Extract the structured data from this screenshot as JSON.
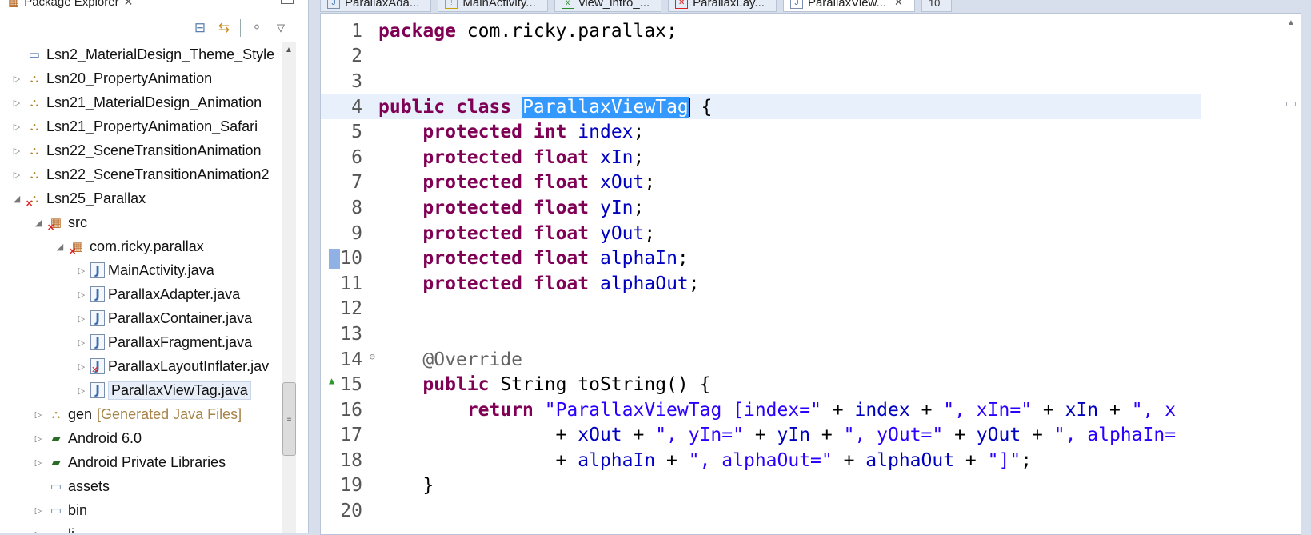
{
  "explorer": {
    "title": "Package Explorer",
    "tree": [
      {
        "depth": 0,
        "arrow": "",
        "icon": "folder-icon",
        "label": "Lsn2_MaterialDesign_Theme_Style"
      },
      {
        "depth": 0,
        "arrow": "▷",
        "icon": "project-icon",
        "label": "Lsn20_PropertyAnimation"
      },
      {
        "depth": 0,
        "arrow": "▷",
        "icon": "project-icon",
        "label": "Lsn21_MaterialDesign_Animation"
      },
      {
        "depth": 0,
        "arrow": "▷",
        "icon": "project-icon",
        "label": "Lsn21_PropertyAnimation_Safari"
      },
      {
        "depth": 0,
        "arrow": "▷",
        "icon": "project-icon",
        "label": "Lsn22_SceneTransitionAnimation"
      },
      {
        "depth": 0,
        "arrow": "▷",
        "icon": "project-icon",
        "label": "Lsn22_SceneTransitionAnimation2"
      },
      {
        "depth": 0,
        "arrow": "◢",
        "icon": "project-error-icon",
        "label": "Lsn25_Parallax"
      },
      {
        "depth": 1,
        "arrow": "◢",
        "icon": "source-folder-error-icon",
        "label": "src"
      },
      {
        "depth": 2,
        "arrow": "◢",
        "icon": "package-error-icon",
        "label": "com.ricky.parallax"
      },
      {
        "depth": 3,
        "arrow": "▷",
        "icon": "java-warning-icon",
        "label": "MainActivity.java"
      },
      {
        "depth": 3,
        "arrow": "▷",
        "icon": "java-file-icon",
        "label": "ParallaxAdapter.java"
      },
      {
        "depth": 3,
        "arrow": "▷",
        "icon": "java-file-icon",
        "label": "ParallaxContainer.java"
      },
      {
        "depth": 3,
        "arrow": "▷",
        "icon": "java-file-icon",
        "label": "ParallaxFragment.java"
      },
      {
        "depth": 3,
        "arrow": "▷",
        "icon": "java-error-icon",
        "label": "ParallaxLayoutInflater.jav"
      },
      {
        "depth": 3,
        "arrow": "▷",
        "icon": "java-file-icon",
        "label": "ParallaxViewTag.java",
        "selected": true
      },
      {
        "depth": 1,
        "arrow": "▷",
        "icon": "gen-folder-icon",
        "label": "gen",
        "hint": "[Generated Java Files]"
      },
      {
        "depth": 1,
        "arrow": "▷",
        "icon": "library-icon",
        "label": "Android 6.0"
      },
      {
        "depth": 1,
        "arrow": "▷",
        "icon": "library-icon",
        "label": "Android Private Libraries"
      },
      {
        "depth": 1,
        "arrow": "",
        "icon": "folder-icon",
        "label": "assets"
      },
      {
        "depth": 1,
        "arrow": "▷",
        "icon": "folder-icon",
        "label": "bin"
      },
      {
        "depth": 1,
        "arrow": "▷",
        "icon": "folder-icon",
        "label": "li"
      }
    ]
  },
  "editor": {
    "tabs": [
      {
        "label": "ParallaxAda...",
        "icon": "java"
      },
      {
        "label": "MainActivity...",
        "icon": "warn"
      },
      {
        "label": "view_intro_...",
        "icon": "xml"
      },
      {
        "label": "ParallaxLay...",
        "icon": "err"
      },
      {
        "label": "ParallaxView...",
        "icon": "java",
        "active": true
      }
    ],
    "overflow_count": "10",
    "lines": [
      {
        "n": "1",
        "tokens": [
          [
            "kw",
            "package"
          ],
          [
            "plain",
            " com.ricky.parallax;"
          ]
        ]
      },
      {
        "n": "2",
        "tokens": []
      },
      {
        "n": "3",
        "tokens": []
      },
      {
        "n": "4",
        "highlight": true,
        "tokens": [
          [
            "kw",
            "public"
          ],
          [
            "plain",
            " "
          ],
          [
            "kw",
            "class"
          ],
          [
            "plain",
            " "
          ],
          [
            "sel",
            "ParallaxViewTag"
          ],
          [
            "caret",
            ""
          ],
          [
            "plain",
            " {"
          ]
        ]
      },
      {
        "n": "5",
        "tokens": [
          [
            "plain",
            "    "
          ],
          [
            "kw",
            "protected"
          ],
          [
            "plain",
            " "
          ],
          [
            "kw",
            "int"
          ],
          [
            "plain",
            " "
          ],
          [
            "fld",
            "index"
          ],
          [
            "plain",
            ";"
          ]
        ]
      },
      {
        "n": "6",
        "tokens": [
          [
            "plain",
            "    "
          ],
          [
            "kw",
            "protected"
          ],
          [
            "plain",
            " "
          ],
          [
            "kw",
            "float"
          ],
          [
            "plain",
            " "
          ],
          [
            "fld",
            "xIn"
          ],
          [
            "plain",
            ";"
          ]
        ]
      },
      {
        "n": "7",
        "tokens": [
          [
            "plain",
            "    "
          ],
          [
            "kw",
            "protected"
          ],
          [
            "plain",
            " "
          ],
          [
            "kw",
            "float"
          ],
          [
            "plain",
            " "
          ],
          [
            "fld",
            "xOut"
          ],
          [
            "plain",
            ";"
          ]
        ]
      },
      {
        "n": "8",
        "tokens": [
          [
            "plain",
            "    "
          ],
          [
            "kw",
            "protected"
          ],
          [
            "plain",
            " "
          ],
          [
            "kw",
            "float"
          ],
          [
            "plain",
            " "
          ],
          [
            "fld",
            "yIn"
          ],
          [
            "plain",
            ";"
          ]
        ]
      },
      {
        "n": "9",
        "tokens": [
          [
            "plain",
            "    "
          ],
          [
            "kw",
            "protected"
          ],
          [
            "plain",
            " "
          ],
          [
            "kw",
            "float"
          ],
          [
            "plain",
            " "
          ],
          [
            "fld",
            "yOut"
          ],
          [
            "plain",
            ";"
          ]
        ]
      },
      {
        "n": "10",
        "bookmark": true,
        "tokens": [
          [
            "plain",
            "    "
          ],
          [
            "kw",
            "protected"
          ],
          [
            "plain",
            " "
          ],
          [
            "kw",
            "float"
          ],
          [
            "plain",
            " "
          ],
          [
            "fld",
            "alphaIn"
          ],
          [
            "plain",
            ";"
          ]
        ]
      },
      {
        "n": "11",
        "tokens": [
          [
            "plain",
            "    "
          ],
          [
            "kw",
            "protected"
          ],
          [
            "plain",
            " "
          ],
          [
            "kw",
            "float"
          ],
          [
            "plain",
            " "
          ],
          [
            "fld",
            "alphaOut"
          ],
          [
            "plain",
            ";"
          ]
        ]
      },
      {
        "n": "12",
        "tokens": []
      },
      {
        "n": "13",
        "tokens": []
      },
      {
        "n": "14",
        "fold": "⊖",
        "tokens": [
          [
            "plain",
            "    "
          ],
          [
            "ann",
            "@Override"
          ]
        ]
      },
      {
        "n": "15",
        "override": "▲",
        "tokens": [
          [
            "plain",
            "    "
          ],
          [
            "kw",
            "public"
          ],
          [
            "plain",
            " String toString() {"
          ]
        ]
      },
      {
        "n": "16",
        "tokens": [
          [
            "plain",
            "        "
          ],
          [
            "kw",
            "return"
          ],
          [
            "plain",
            " "
          ],
          [
            "str",
            "\"ParallaxViewTag [index=\""
          ],
          [
            "plain",
            " + "
          ],
          [
            "fld",
            "index"
          ],
          [
            "plain",
            " + "
          ],
          [
            "str",
            "\", xIn=\""
          ],
          [
            "plain",
            " + "
          ],
          [
            "fld",
            "xIn"
          ],
          [
            "plain",
            " + "
          ],
          [
            "str",
            "\", x"
          ]
        ]
      },
      {
        "n": "17",
        "tokens": [
          [
            "plain",
            "                + "
          ],
          [
            "fld",
            "xOut"
          ],
          [
            "plain",
            " + "
          ],
          [
            "str",
            "\", yIn=\""
          ],
          [
            "plain",
            " + "
          ],
          [
            "fld",
            "yIn"
          ],
          [
            "plain",
            " + "
          ],
          [
            "str",
            "\", yOut=\""
          ],
          [
            "plain",
            " + "
          ],
          [
            "fld",
            "yOut"
          ],
          [
            "plain",
            " + "
          ],
          [
            "str",
            "\", alphaIn="
          ]
        ]
      },
      {
        "n": "18",
        "tokens": [
          [
            "plain",
            "                + "
          ],
          [
            "fld",
            "alphaIn"
          ],
          [
            "plain",
            " + "
          ],
          [
            "str",
            "\", alphaOut=\""
          ],
          [
            "plain",
            " + "
          ],
          [
            "fld",
            "alphaOut"
          ],
          [
            "plain",
            " + "
          ],
          [
            "str",
            "\"]\""
          ],
          [
            "plain",
            ";"
          ]
        ]
      },
      {
        "n": "19",
        "tokens": [
          [
            "plain",
            "    }"
          ]
        ]
      },
      {
        "n": "20",
        "tokens": []
      }
    ]
  }
}
